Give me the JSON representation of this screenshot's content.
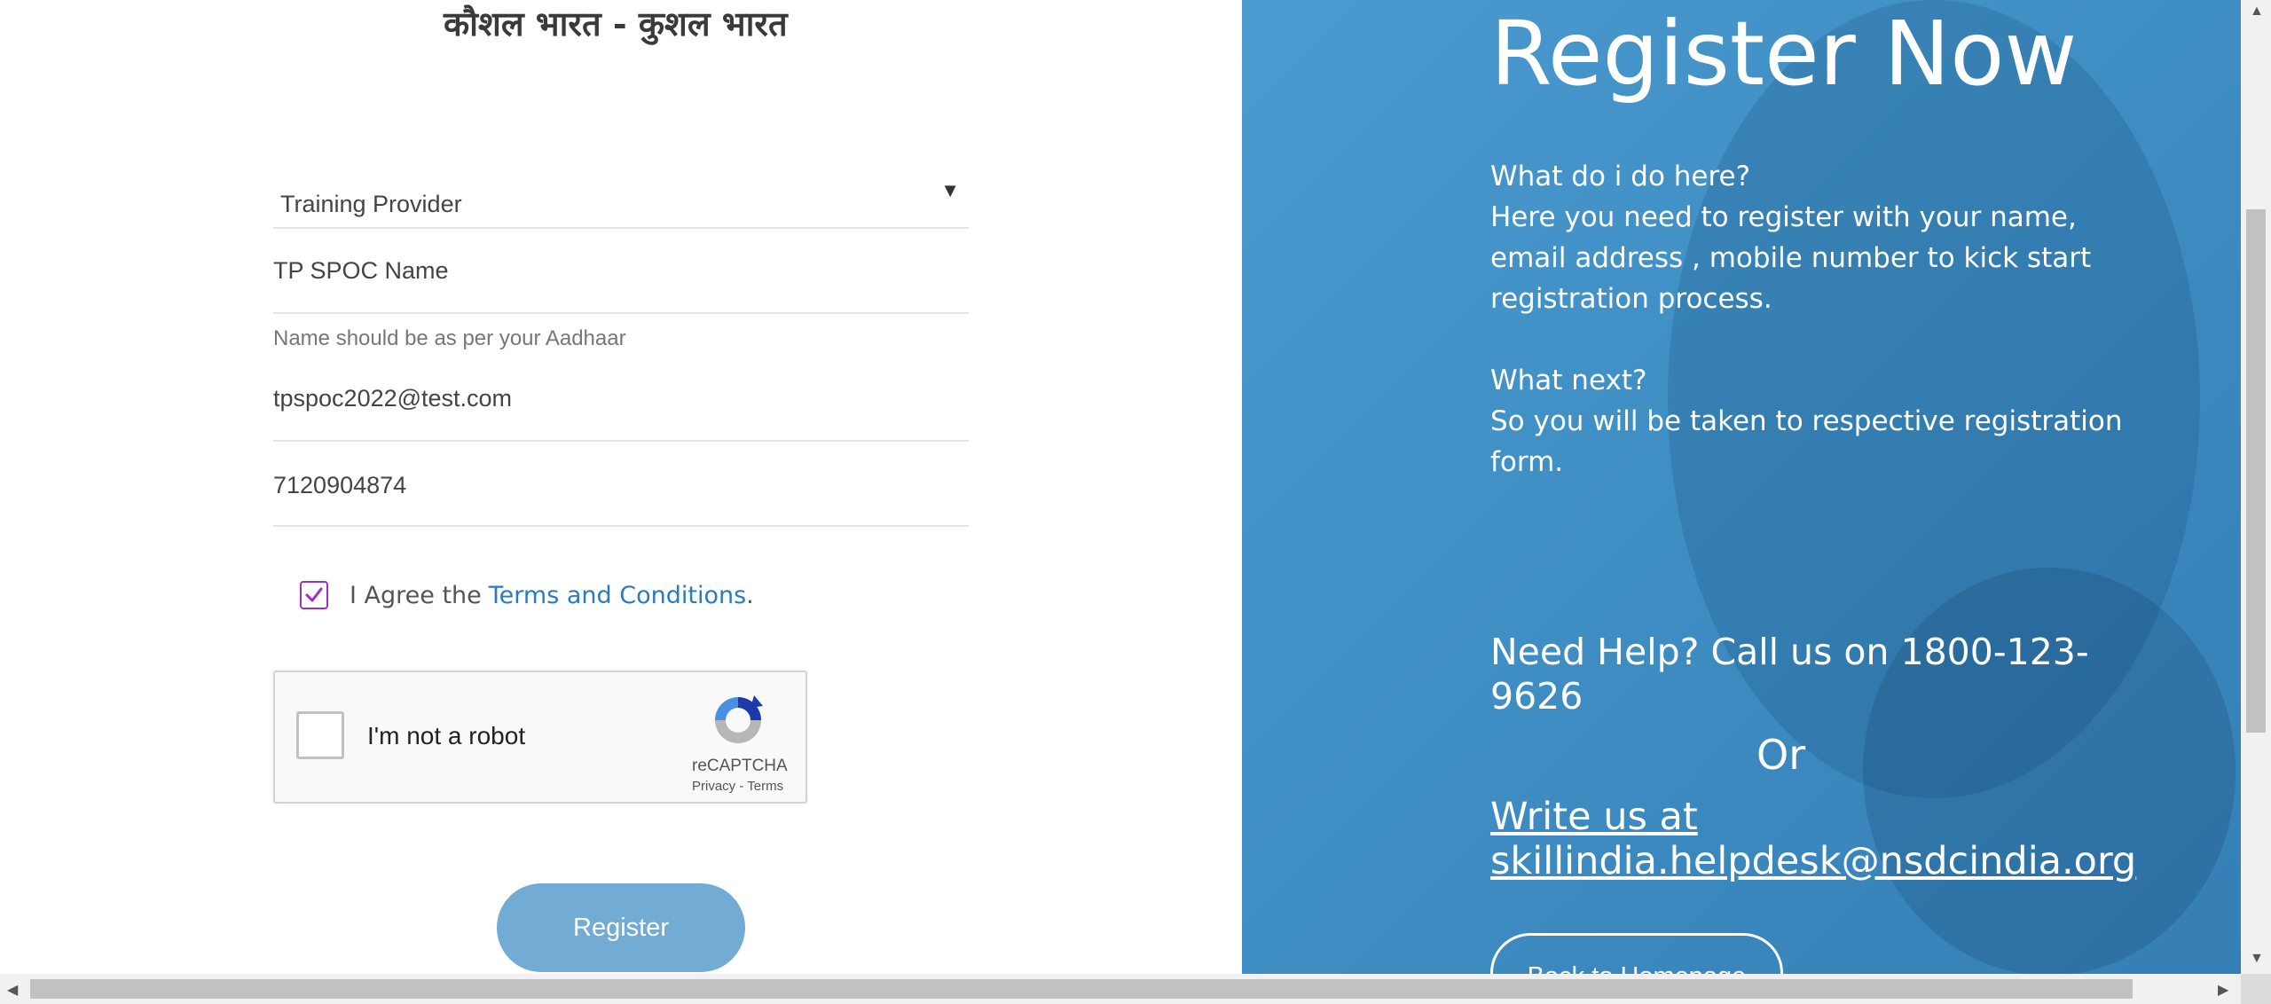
{
  "logo": {
    "text": "कौशल भारत - कुशल भारत"
  },
  "form": {
    "user_type": "Training Provider",
    "spoc_name_placeholder": "TP SPOC Name",
    "name_helper": "Name should be as per your Aadhaar",
    "email": "tpspoc2022@test.com",
    "mobile": "7120904874",
    "agree_prefix": "I Agree the",
    "terms_link": "Terms and Conditions",
    "agree_suffix": ".",
    "register_label": "Register"
  },
  "recaptcha": {
    "label": "I'm not a robot",
    "brand": "reCAPTCHA",
    "links": "Privacy - Terms"
  },
  "panel": {
    "title": "Register Now",
    "q1": "What do i do here?",
    "a1": "Here you need to register with your name, email address , mobile number to kick start registration process.",
    "q2": "What next?",
    "a2": "So you will be taken to respective registration form.",
    "help": "Need Help? Call us on 1800-123-9626",
    "or": "Or",
    "write_us": "Write us at skillindia.helpdesk@nsdcindia.org",
    "back_label": "Back to Homepage"
  },
  "colors": {
    "accent_blue": "#4a9bd0",
    "register_button": "#72abd3",
    "link": "#2d7bb8",
    "checkbox": "#9b30c9"
  }
}
